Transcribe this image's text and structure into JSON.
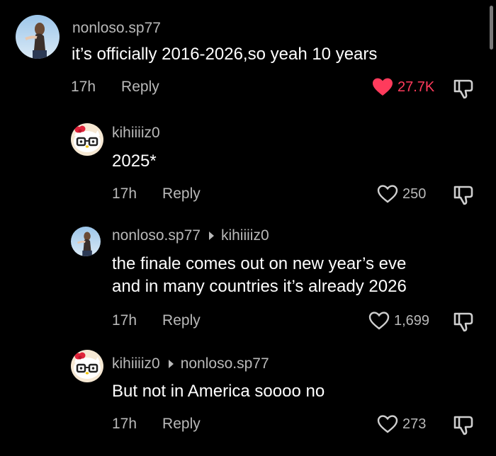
{
  "comments": [
    {
      "author": "nonloso.sp77",
      "reply_to": "",
      "text_lines": [
        "it’s officially 2016-2026,so yeah 10 years"
      ],
      "time": "17h",
      "reply_label": "Reply",
      "likes": "27.7K",
      "liked": true,
      "avatar": "profile-photo-avatar"
    },
    {
      "author": "kihiiiiz0",
      "reply_to": "",
      "text_lines": [
        "2025*"
      ],
      "time": "17h",
      "reply_label": "Reply",
      "likes": "250",
      "liked": false,
      "avatar": "hello-kitty-avatar"
    },
    {
      "author": "nonloso.sp77",
      "reply_to": "kihiiiiz0",
      "text_lines": [
        "the finale comes out on new year’s eve",
        "and in many countries it’s already 2026"
      ],
      "time": "17h",
      "reply_label": "Reply",
      "likes": "1,699",
      "liked": false,
      "avatar": "profile-photo-avatar"
    },
    {
      "author": "kihiiiiz0",
      "reply_to": "nonloso.sp77",
      "text_lines": [
        "But not in America soooo no"
      ],
      "time": "17h",
      "reply_label": "Reply",
      "likes": "273",
      "liked": false,
      "avatar": "hello-kitty-avatar"
    }
  ],
  "colors": {
    "background": "#000000",
    "secondary_text": "#b9b9b9",
    "liked_red": "#ff3b5c"
  }
}
